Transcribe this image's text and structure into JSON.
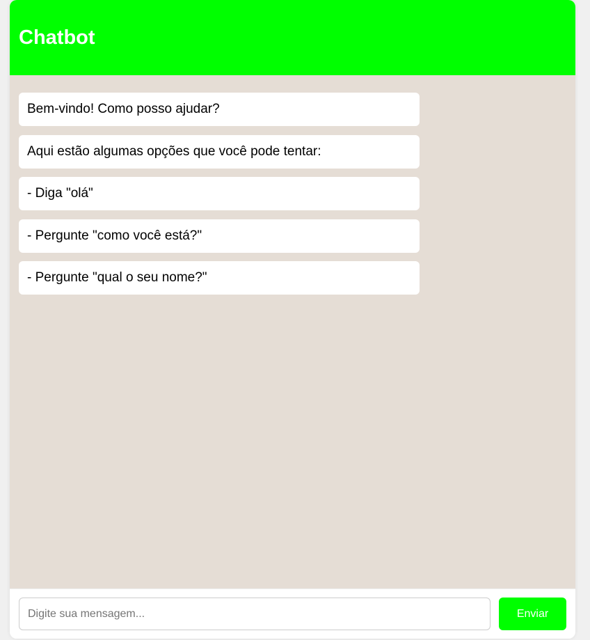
{
  "header": {
    "title": "Chatbot"
  },
  "messages": [
    {
      "text": "Bem-vindo! Como posso ajudar?"
    },
    {
      "text": "Aqui estão algumas opções que você pode tentar:"
    },
    {
      "text": "- Diga \"olá\""
    },
    {
      "text": "- Pergunte \"como você está?\""
    },
    {
      "text": "- Pergunte \"qual o seu nome?\""
    }
  ],
  "input": {
    "value": "",
    "placeholder": "Digite sua mensagem..."
  },
  "send_button": {
    "label": "Enviar"
  },
  "colors": {
    "accent": "#00ff00",
    "chat_background": "#e5ddd5",
    "bubble": "#ffffff"
  }
}
